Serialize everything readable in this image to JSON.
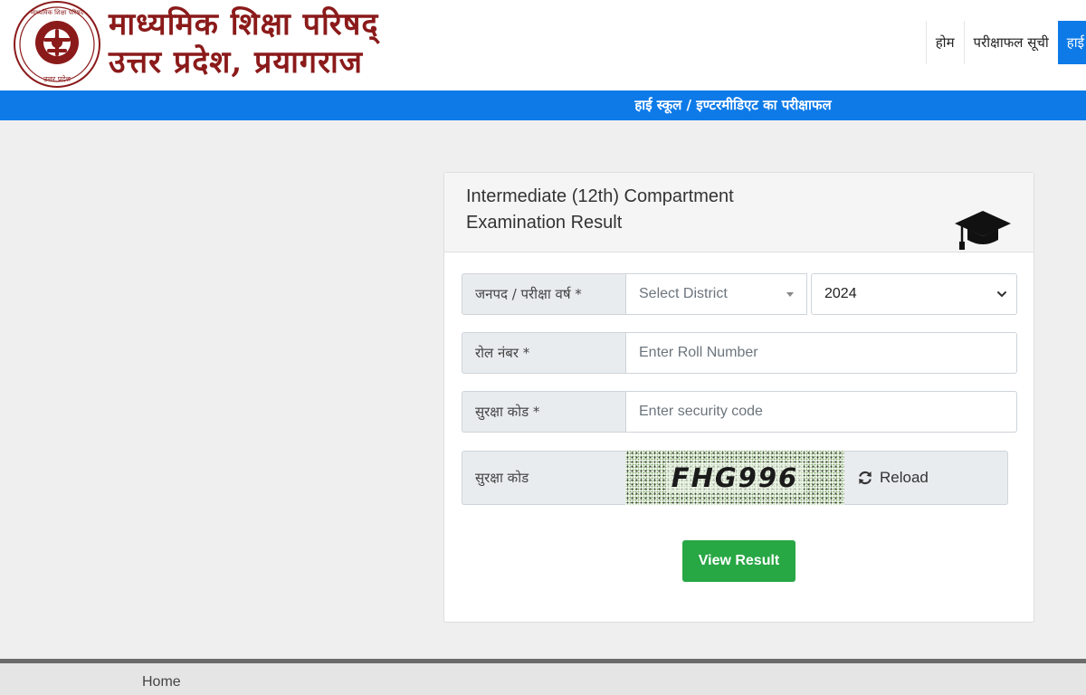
{
  "header": {
    "org_title_line1": "माध्यमिक शिक्षा परिषद्",
    "org_title_line2": "उत्तर प्रदेश, प्रयागराज",
    "logo_text_top": "माध्यमिक शिक्षा परिषद",
    "logo_text_bottom": "उत्तर प्रदेश",
    "nav": [
      {
        "label": "होम"
      },
      {
        "label": "परीक्षाफल सूची"
      },
      {
        "label": "हाई"
      }
    ]
  },
  "banner": {
    "text": "हाई स्कूल / इण्टरमीडिएट का परीक्षाफल"
  },
  "card": {
    "title": "Intermediate (12th) Compartment Examination Result",
    "icon": "graduation-cap-icon"
  },
  "form": {
    "district_label": "जनपद / परीक्षा वर्ष *",
    "district_placeholder": "Select District",
    "year_value": "2024",
    "roll_label": "रोल नंबर *",
    "roll_placeholder": "Enter Roll Number",
    "security_label": "सुरक्षा कोड *",
    "security_placeholder": "Enter security code",
    "captcha_label": "सुरक्षा कोड",
    "captcha_text": "FHG996",
    "reload_label": "Reload",
    "submit_label": "View Result"
  },
  "footer": {
    "home_label": "Home"
  },
  "colors": {
    "brand_blue": "#0d7ae8",
    "title_maroon": "#8b1a1a",
    "submit_green": "#28a745"
  }
}
